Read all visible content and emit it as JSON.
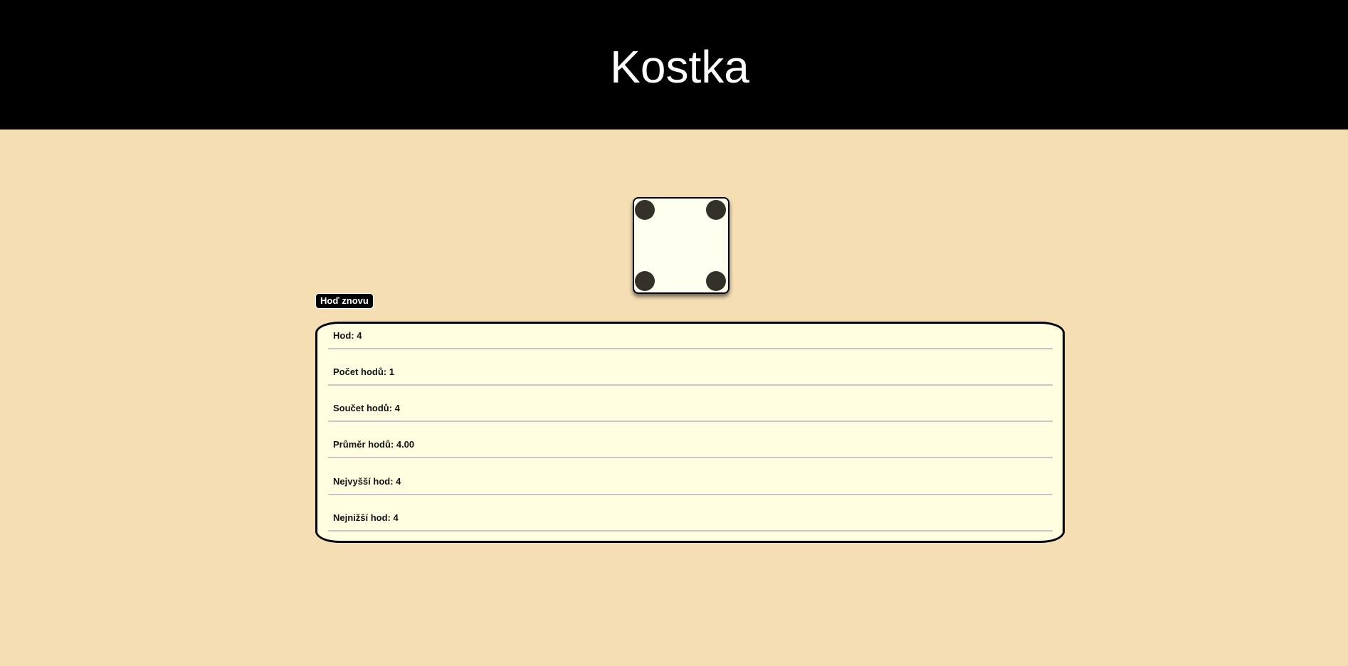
{
  "header": {
    "title": "Kostka"
  },
  "die": {
    "value": 4,
    "pips": [
      "top-left",
      "top-right",
      "bottom-left",
      "bottom-right"
    ],
    "face_color": "#fffff0",
    "pip_color": "#34302a"
  },
  "controls": {
    "roll_again_label": "Hoď znovu"
  },
  "stats": {
    "rows": [
      {
        "label": "Hod: 4"
      },
      {
        "label": "Počet hodů: 1"
      },
      {
        "label": "Součet hodů: 4"
      },
      {
        "label": "Průměr hodů: 4.00"
      },
      {
        "label": "Nejvyšší hod: 4"
      },
      {
        "label": "Nejnižší hod: 4"
      }
    ]
  },
  "colors": {
    "background": "#f5deb3",
    "header_bg": "#000000",
    "panel_bg": "#fffee0",
    "divider": "#c8c8cc"
  }
}
